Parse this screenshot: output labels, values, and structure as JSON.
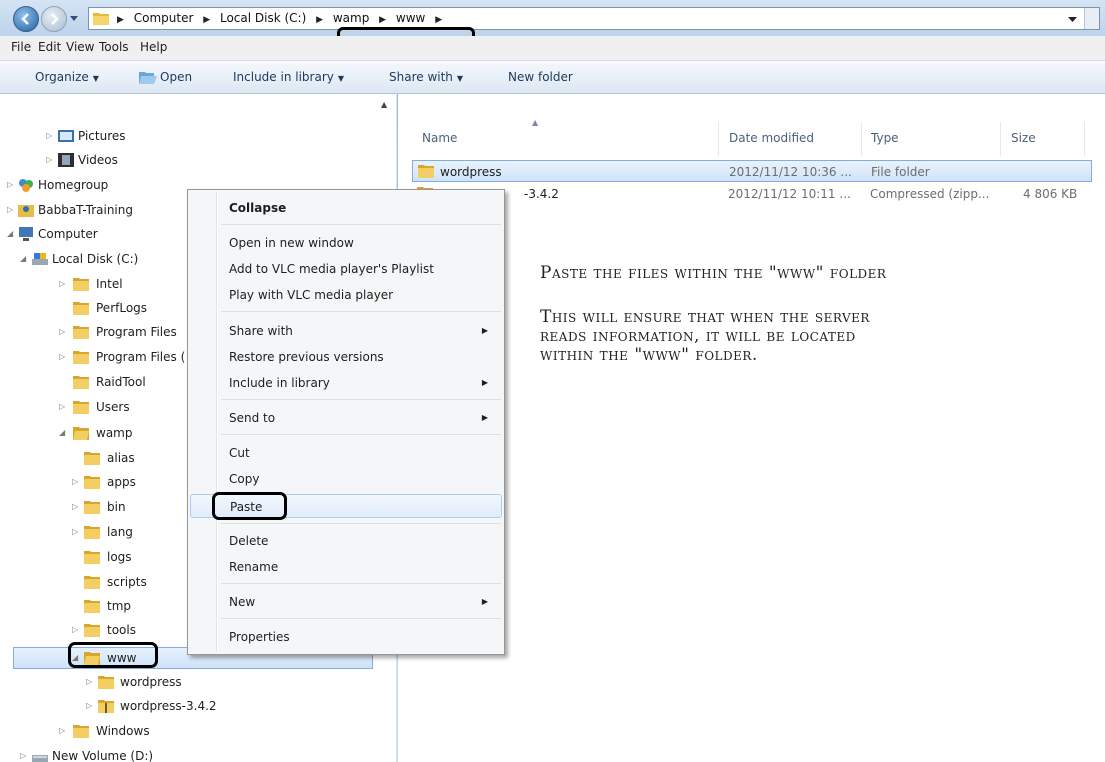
{
  "address": {
    "crumbs": [
      "Computer",
      "Local Disk (C:)",
      "wamp",
      "www"
    ]
  },
  "menubar": [
    "File",
    "Edit",
    "View",
    "Tools",
    "Help"
  ],
  "toolbar": {
    "organize": "Organize",
    "open": "Open",
    "include": "Include in library",
    "share": "Share with",
    "newfolder": "New folder"
  },
  "tree": {
    "pictures": "Pictures",
    "videos": "Videos",
    "homegroup": "Homegroup",
    "babbat": "BabbaT-Training",
    "computer": "Computer",
    "localdisk": "Local Disk (C:)",
    "intel": "Intel",
    "perflogs": "PerfLogs",
    "programfiles": "Program Files",
    "programfilesx": "Program Files (",
    "raidtool": "RaidTool",
    "users": "Users",
    "wamp": "wamp",
    "alias": "alias",
    "apps": "apps",
    "bin": "bin",
    "lang": "lang",
    "logs": "logs",
    "scripts": "scripts",
    "tmp": "tmp",
    "tools": "tools",
    "www": "www",
    "wordpress": "wordpress",
    "wordpresszip": "wordpress-3.4.2",
    "windows": "Windows",
    "newvolume": "New Volume (D:)"
  },
  "columns": {
    "name": "Name",
    "date": "Date modified",
    "type": "Type",
    "size": "Size"
  },
  "files": [
    {
      "name": "wordpress",
      "date": "2012/11/12 10:36 ...",
      "type": "File folder",
      "size": ""
    },
    {
      "name": "-3.4.2",
      "date": "2012/11/12 10:11 ...",
      "type": "Compressed (zipp...",
      "size": "4 806 KB"
    }
  ],
  "note": {
    "line1": "Paste the files within the \"www\" folder",
    "line2": "This will ensure that when the server",
    "line3": "reads information, it will be located",
    "line4": "within the \"www\" folder."
  },
  "context_menu": {
    "collapse": "Collapse",
    "open_new": "Open in new window",
    "vlc_add": "Add to VLC media player's Playlist",
    "vlc_play": "Play with VLC media player",
    "share": "Share with",
    "restore": "Restore previous versions",
    "include": "Include in library",
    "sendto": "Send to",
    "cut": "Cut",
    "copy": "Copy",
    "paste": "Paste",
    "delete": "Delete",
    "rename": "Rename",
    "new": "New",
    "properties": "Properties"
  }
}
